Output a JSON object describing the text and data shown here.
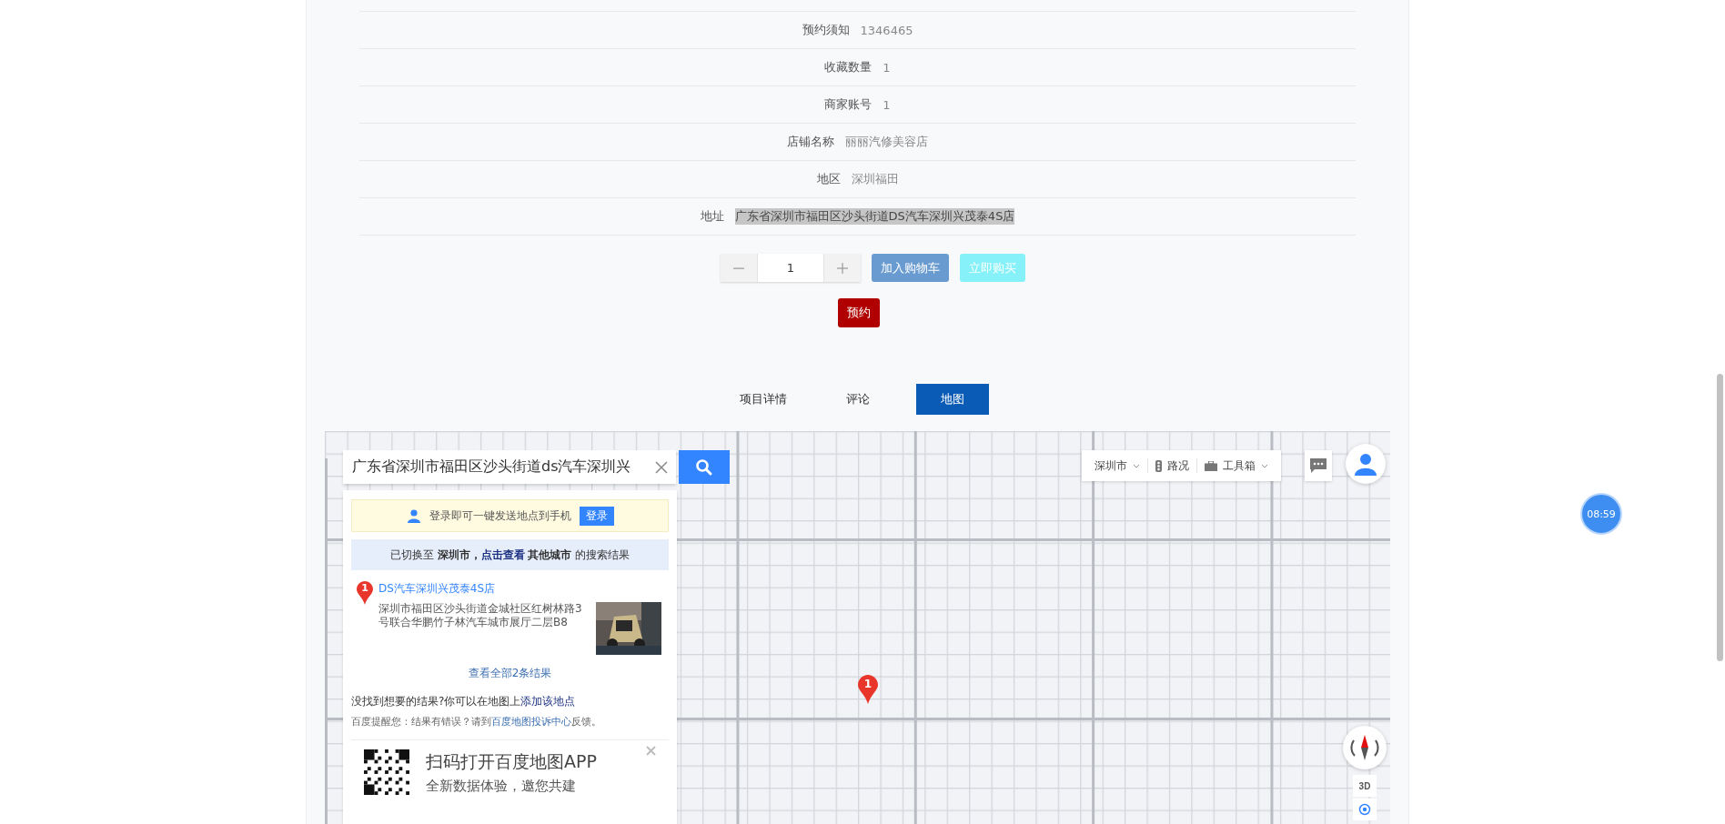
{
  "details": [
    {
      "label": "预约须知",
      "value": "1346465",
      "highlighted": false
    },
    {
      "label": "收藏数量",
      "value": "1",
      "highlighted": false
    },
    {
      "label": "商家账号",
      "value": "1",
      "highlighted": false
    },
    {
      "label": "店铺名称",
      "value": "丽丽汽修美容店",
      "highlighted": false
    },
    {
      "label": "地区",
      "value": "深圳福田",
      "highlighted": false
    },
    {
      "label": "地址",
      "value": "广东省深圳市福田区沙头街道DS汽车深圳兴茂泰4S店",
      "highlighted": true
    }
  ],
  "quantity": {
    "value": "1"
  },
  "buttons": [
    {
      "kind": "cart",
      "label": "加入购物车"
    },
    {
      "kind": "buy",
      "label": "立即购买"
    }
  ],
  "reserve_button": "预约",
  "tabs": [
    {
      "label": "项目详情",
      "selected": false
    },
    {
      "label": "评论",
      "selected": false
    },
    {
      "label": "地图",
      "selected": true
    }
  ],
  "map": {
    "search": {
      "value": "广东省深圳市福田区沙头街道ds汽车深圳兴"
    },
    "login_bar": {
      "text": "登录即可一键发送地点到手机",
      "button": "登录"
    },
    "city_notice": {
      "prefix": "已切换至",
      "city": "深圳市，",
      "link": "点击查看",
      "other": "其他城市",
      "suffix": "的搜索结果"
    },
    "result": {
      "index": "1",
      "title": "DS汽车深圳兴茂泰4S店",
      "address": "深圳市福田区沙头街道金城社区红树林路3号联合华鹏竹子林汽车城市展厅二层B8"
    },
    "view_all": "查看全部2条结果",
    "not_found": {
      "text": "没找到想要的结果?你可以在地图上",
      "link": "添加该地点"
    },
    "reminder": {
      "text": "百度提醒您：结果有错误？请到",
      "link": "百度地图投诉中心",
      "suffix": "反馈。"
    },
    "app_promo": {
      "title": "扫码打开百度地图APP",
      "subtitle": "全新数据体验，邀您共建"
    },
    "city_select": "深圳市",
    "traffic": "路况",
    "toolbox": "工具箱",
    "view_3d": "3D",
    "marker": "1"
  },
  "clock": "08:59"
}
